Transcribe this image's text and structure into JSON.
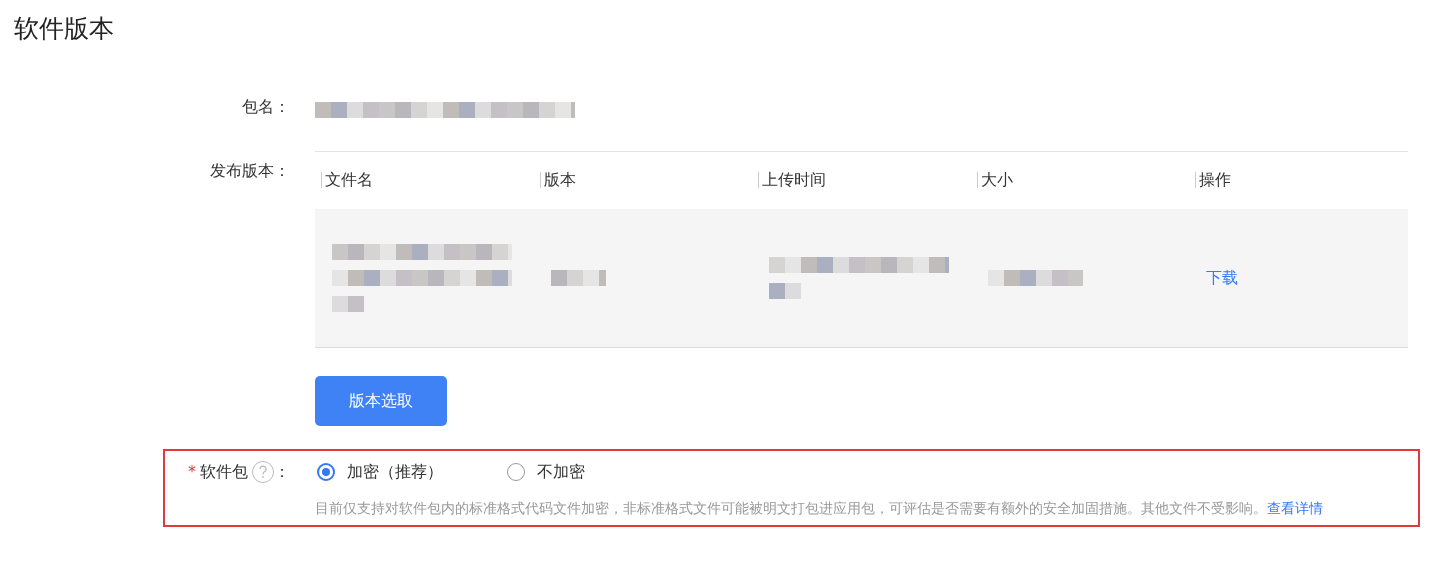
{
  "page_title": "软件版本",
  "package_name": {
    "label": "包名：",
    "value": {
      "kind": "redacted"
    }
  },
  "release": {
    "label": "发布版本：",
    "table": {
      "columns": [
        "文件名",
        "版本",
        "上传时间",
        "大小",
        "操作"
      ],
      "rows": [
        {
          "cells": [
            {
              "kind": "redacted"
            },
            {
              "kind": "redacted"
            },
            {
              "kind": "redacted"
            },
            {
              "kind": "redacted"
            },
            {
              "kind": "link",
              "text": "下载"
            }
          ]
        }
      ]
    },
    "button": "版本选取"
  },
  "software_package": {
    "label": "软件包",
    "required_mark": "*",
    "colon": "：",
    "highlighted": true,
    "options": [
      {
        "label": "加密（推荐）",
        "selected": true
      },
      {
        "label": "不加密",
        "selected": false
      }
    ],
    "note": "目前仅支持对软件包内的标准格式代码文件加密，非标准格式文件可能被明文打包进应用包，可评估是否需要有额外的安全加固措施。其他文件不受影响。",
    "note_link": "查看详情"
  }
}
